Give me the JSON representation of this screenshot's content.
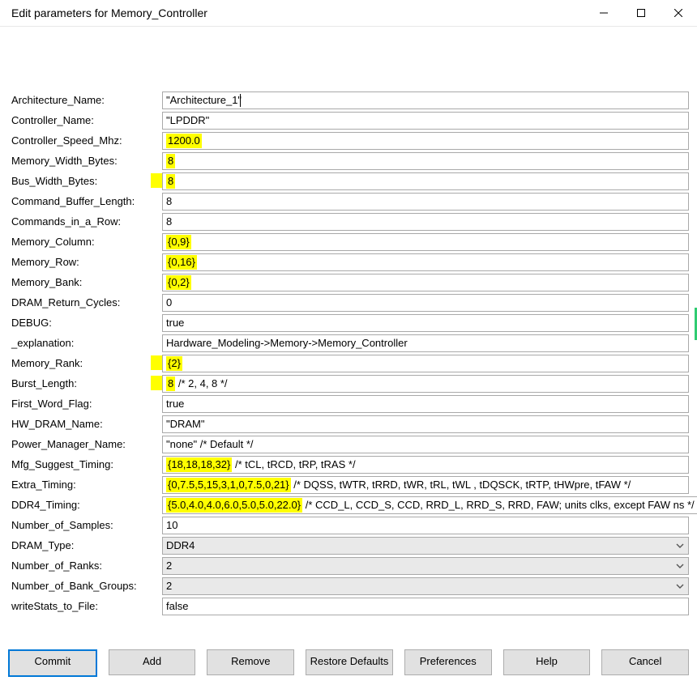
{
  "window": {
    "title": "Edit parameters for Memory_Controller"
  },
  "params": {
    "Architecture_Name": {
      "label": "Architecture_Name:",
      "value_pre": "",
      "value_hl": "",
      "value_post": "\"Architecture_1\"",
      "type": "text",
      "cursor": true
    },
    "Controller_Name": {
      "label": "Controller_Name:",
      "value_pre": "",
      "value_hl": "",
      "value_post": "\"LPDDR\"",
      "type": "text"
    },
    "Controller_Speed_Mhz": {
      "label": "Controller_Speed_Mhz:",
      "value_pre": "",
      "value_hl": "1200.0",
      "value_post": "",
      "type": "text"
    },
    "Memory_Width_Bytes": {
      "label": "Memory_Width_Bytes:",
      "value_pre": "",
      "value_hl": "8",
      "value_post": "",
      "type": "text"
    },
    "Bus_Width_Bytes": {
      "label": "Bus_Width_Bytes:",
      "value_pre": "",
      "value_hl": "8",
      "value_post": "",
      "type": "text",
      "leading_hl": true
    },
    "Command_Buffer_Length": {
      "label": "Command_Buffer_Length:",
      "value_pre": "",
      "value_hl": "",
      "value_post": "8",
      "type": "text"
    },
    "Commands_in_a_Row": {
      "label": "Commands_in_a_Row:",
      "value_pre": "",
      "value_hl": "",
      "value_post": "8",
      "type": "text"
    },
    "Memory_Column": {
      "label": "Memory_Column:",
      "value_pre": "",
      "value_hl": "{0,9}",
      "value_post": "",
      "type": "text"
    },
    "Memory_Row": {
      "label": "Memory_Row:",
      "value_pre": "",
      "value_hl": "{0,16}",
      "value_post": "",
      "type": "text"
    },
    "Memory_Bank": {
      "label": "Memory_Bank:",
      "value_pre": "",
      "value_hl": "{0,2}",
      "value_post": "",
      "type": "text"
    },
    "DRAM_Return_Cycles": {
      "label": "DRAM_Return_Cycles:",
      "value_pre": "",
      "value_hl": "",
      "value_post": "0",
      "type": "text"
    },
    "DEBUG": {
      "label": "DEBUG:",
      "value_pre": "",
      "value_hl": "",
      "value_post": "true",
      "type": "text"
    },
    "_explanation": {
      "label": "_explanation:",
      "value_pre": "",
      "value_hl": "",
      "value_post": "Hardware_Modeling->Memory->Memory_Controller",
      "type": "text"
    },
    "Memory_Rank": {
      "label": "Memory_Rank:",
      "value_pre": "",
      "value_hl": "{2}",
      "value_post": "",
      "type": "text",
      "leading_hl": true
    },
    "Burst_Length": {
      "label": "Burst_Length:",
      "value_pre": "",
      "value_hl": "8",
      "value_post": " /* 2, 4, 8 */",
      "type": "text",
      "leading_hl": true
    },
    "First_Word_Flag": {
      "label": "First_Word_Flag:",
      "value_pre": "",
      "value_hl": "",
      "value_post": "true",
      "type": "text"
    },
    "HW_DRAM_Name": {
      "label": "HW_DRAM_Name:",
      "value_pre": "",
      "value_hl": "",
      "value_post": "\"DRAM\"",
      "type": "text"
    },
    "Power_Manager_Name": {
      "label": "Power_Manager_Name:",
      "value_pre": "",
      "value_hl": "",
      "value_post": "\"none\"  /* Default */",
      "type": "text"
    },
    "Mfg_Suggest_Timing": {
      "label": "Mfg_Suggest_Timing:",
      "value_pre": "",
      "value_hl": "{18,18,18,32}",
      "value_post": " /* tCL, tRCD, tRP, tRAS */",
      "type": "text"
    },
    "Extra_Timing": {
      "label": "Extra_Timing:",
      "value_pre": "",
      "value_hl": "{0,7.5,5,15,3,1,0,7.5,0,21}",
      "value_post": " /* DQSS, tWTR, tRRD, tWR, tRL, tWL , tDQSCK, tRTP, tHWpre, tFAW */",
      "type": "text"
    },
    "DDR4_Timing": {
      "label": "DDR4_Timing:",
      "value_pre": "",
      "value_hl": "{5.0,4.0,4.0,6.0,5.0,5.0,22.0}",
      "value_post": " /* CCD_L, CCD_S, CCD, RRD_L, RRD_S, RRD, FAW; units clks, except FAW ns */",
      "type": "text"
    },
    "Number_of_Samples": {
      "label": "Number_of_Samples:",
      "value_pre": "",
      "value_hl": "",
      "value_post": "10",
      "type": "text"
    },
    "DRAM_Type": {
      "label": "DRAM_Type:",
      "value_pre": "",
      "value_hl": "",
      "value_post": "DDR4",
      "type": "select"
    },
    "Number_of_Ranks": {
      "label": "Number_of_Ranks:",
      "value_pre": "",
      "value_hl": "",
      "value_post": "2",
      "type": "select"
    },
    "Number_of_Bank_Groups": {
      "label": "Number_of_Bank_Groups:",
      "value_pre": "",
      "value_hl": "",
      "value_post": "2",
      "type": "select"
    },
    "writeStats_to_File": {
      "label": "writeStats_to_File:",
      "value_pre": "",
      "value_hl": "",
      "value_post": "false",
      "type": "text"
    }
  },
  "param_order": [
    "Architecture_Name",
    "Controller_Name",
    "Controller_Speed_Mhz",
    "Memory_Width_Bytes",
    "Bus_Width_Bytes",
    "Command_Buffer_Length",
    "Commands_in_a_Row",
    "Memory_Column",
    "Memory_Row",
    "Memory_Bank",
    "DRAM_Return_Cycles",
    "DEBUG",
    "_explanation",
    "Memory_Rank",
    "Burst_Length",
    "First_Word_Flag",
    "HW_DRAM_Name",
    "Power_Manager_Name",
    "Mfg_Suggest_Timing",
    "Extra_Timing",
    "DDR4_Timing",
    "Number_of_Samples",
    "DRAM_Type",
    "Number_of_Ranks",
    "Number_of_Bank_Groups",
    "writeStats_to_File"
  ],
  "buttons": {
    "commit": "Commit",
    "add": "Add",
    "remove": "Remove",
    "restore": "Restore Defaults",
    "prefs": "Preferences",
    "help": "Help",
    "cancel": "Cancel"
  }
}
